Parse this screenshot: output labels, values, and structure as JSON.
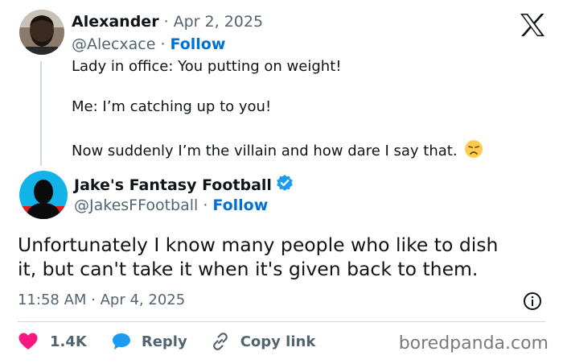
{
  "original_tweet": {
    "author_name": "Alexander",
    "separator": "·",
    "date": "Apr 2, 2025",
    "handle": "@Alecxace",
    "follow_label": "Follow",
    "lines": [
      "Lady in office: You putting on weight!",
      "Me: I’m catching up to you!",
      "Now suddenly I’m the villain and how dare I say that."
    ],
    "emoji": "disappointed-face-emoji"
  },
  "reply_tweet": {
    "author_name": "Jake's Fantasy Football",
    "verified_icon": "verified-badge-icon",
    "handle": "@JakesFFootball",
    "separator": "·",
    "follow_label": "Follow",
    "lines": [
      "Unfortunately I know many people who like to dish",
      "it, but can't take it when it's given back to them."
    ],
    "timestamp": "11:58 AM · Apr 4, 2025"
  },
  "actions": {
    "likes_count": "1.4K",
    "reply_label": "Reply",
    "copy_link_label": "Copy link"
  },
  "watermark": "boredpanda.com",
  "colors": {
    "follow_blue": "#006fd6",
    "like_red": "#f91880",
    "reply_blue": "#1d9bf0",
    "muted_text": "#536471"
  }
}
